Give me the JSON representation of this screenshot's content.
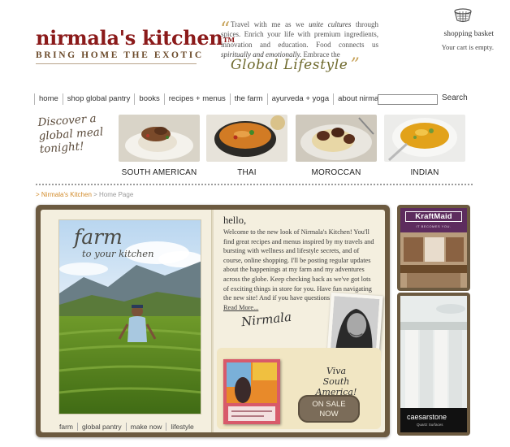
{
  "brand": {
    "name": "nirmala's kitchen",
    "trademark": "TM",
    "tagline": "BRING HOME THE EXOTIC"
  },
  "quote": {
    "open_mark": "“",
    "part1": "Travel with me as we ",
    "emph1": "unite cultures",
    "part2": " through spices. Enrich your life with premium ingredients, innovation and education. Food connects us ",
    "emph2": "spiritually and emotionally.",
    "part3": " Embrace the",
    "highlight": "Global Lifestyle",
    "close_mark": "”"
  },
  "cart": {
    "icon": "shopping-basket-icon",
    "label": "shopping basket",
    "status": "Your cart is empty."
  },
  "nav": {
    "items": [
      "home",
      "shop global pantry",
      "books",
      "recipes + menus",
      "the farm",
      "ayurveda + yoga",
      "about nirmala"
    ]
  },
  "search": {
    "value": "",
    "button_label": "Search"
  },
  "discover": {
    "text": "Discover a global meal tonight!"
  },
  "cuisines": [
    {
      "label": "SOUTH AMERICAN"
    },
    {
      "label": "THAI"
    },
    {
      "label": "MOROCCAN"
    },
    {
      "label": "INDIAN"
    }
  ],
  "breadcrumb": {
    "link": "> Nirmala's Kitchen",
    "current": "> Home Page"
  },
  "book": {
    "farm_title": "farm",
    "farm_subtitle": "to your kitchen",
    "farm_links": [
      "farm",
      "global pantry",
      "make now",
      "lifestyle"
    ],
    "hello": "hello,",
    "welcome": "Welcome to the new look of Nirmala's Kitchen! You'll find great recipes and menus inspired by my travels and bursting with wellness and lifestyle secrets, and of course, online shopping. I'll be posting regular updates about the happenings at my farm and my adventures across the globe. Keep checking back as we've got lots of exciting things in store for you. Have fun navigating the new site! And if you have questions or comments, ",
    "read_more": "Read More...",
    "signature": "Nirmala",
    "promo_line1": "Viva",
    "promo_line2": "South America!",
    "on_sale_line1": "ON SALE",
    "on_sale_line2": "NOW"
  },
  "ads": {
    "ad1_brand": "KraftMaid",
    "ad1_tag": "IT BECOMES YOU.",
    "ad2_brand": "caesarstone",
    "ad2_tag": "Quartz Surfaces"
  },
  "colors": {
    "brand": "#8b1a1a",
    "accent_gold": "#c7a35a",
    "book_frame": "#6c5a40",
    "page": "#f4efdf",
    "link_orange": "#d28b2a"
  }
}
